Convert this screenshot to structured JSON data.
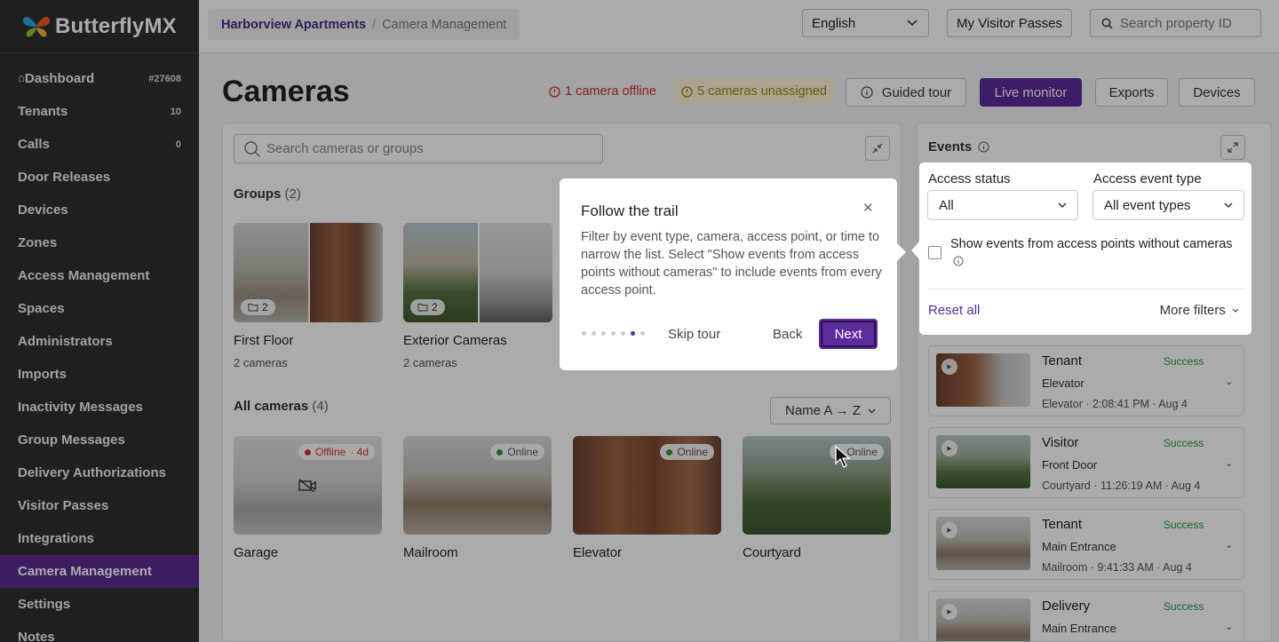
{
  "brand": {
    "name": "ButterflyMX"
  },
  "sidebar": {
    "items": [
      {
        "label": "Dashboard",
        "count": "#27608"
      },
      {
        "label": "Tenants",
        "count": "10"
      },
      {
        "label": "Calls",
        "count": "0"
      },
      {
        "label": "Door Releases",
        "count": ""
      },
      {
        "label": "Devices",
        "count": ""
      },
      {
        "label": "Zones",
        "count": ""
      },
      {
        "label": "Access Management",
        "count": ""
      },
      {
        "label": "Spaces",
        "count": ""
      },
      {
        "label": "Administrators",
        "count": ""
      },
      {
        "label": "Imports",
        "count": ""
      },
      {
        "label": "Inactivity Messages",
        "count": ""
      },
      {
        "label": "Group Messages",
        "count": ""
      },
      {
        "label": "Delivery Authorizations",
        "count": ""
      },
      {
        "label": "Visitor Passes",
        "count": ""
      },
      {
        "label": "Integrations",
        "count": ""
      },
      {
        "label": "Camera Management",
        "count": ""
      },
      {
        "label": "Settings",
        "count": ""
      },
      {
        "label": "Notes",
        "count": ""
      }
    ],
    "active_index": 15
  },
  "topbar": {
    "breadcrumb": {
      "property": "Harborview Apartments",
      "separator": "/",
      "page": "Camera Management"
    },
    "language": "English",
    "visitor_passes": "My Visitor Passes",
    "search_placeholder": "Search property ID"
  },
  "header": {
    "title": "Cameras",
    "offline": "1 camera offline",
    "unassigned": "5 cameras unassigned",
    "guided_tour": "Guided tour",
    "live_monitor": "Live monitor",
    "exports": "Exports",
    "devices": "Devices"
  },
  "cameras_panel": {
    "search_placeholder": "Search cameras or groups",
    "groups_label": "Groups",
    "groups_count": "(2)",
    "groups": [
      {
        "name": "First Floor",
        "sub": "2 cameras",
        "count": "2"
      },
      {
        "name": "Exterior Cameras",
        "sub": "2 cameras",
        "count": "2"
      }
    ],
    "all_label": "All cameras",
    "all_count": "(4)",
    "sort": "Name A → Z",
    "cameras": [
      {
        "name": "Garage",
        "status": "Offline",
        "extra": "· 4d"
      },
      {
        "name": "Mailroom",
        "status": "Online",
        "extra": ""
      },
      {
        "name": "Elevator",
        "status": "Online",
        "extra": ""
      },
      {
        "name": "Courtyard",
        "status": "Online",
        "extra": ""
      }
    ]
  },
  "events": {
    "title": "Events",
    "filters": {
      "access_status_label": "Access status",
      "access_status_value": "All",
      "event_type_label": "Access event type",
      "event_type_value": "All event types",
      "checkbox_label": "Show events from access points without cameras",
      "reset": "Reset all",
      "more": "More filters"
    },
    "items": [
      {
        "type": "Tenant",
        "status": "Success",
        "location": "Elevator",
        "meta": "Elevator · 2:08:41 PM · Aug 4"
      },
      {
        "type": "Visitor",
        "status": "Success",
        "location": "Front Door",
        "meta": "Courtyard · 11:26:19 AM · Aug 4"
      },
      {
        "type": "Tenant",
        "status": "Success",
        "location": "Main Entrance",
        "meta": "Mailroom · 9:41:33 AM · Aug 4"
      },
      {
        "type": "Delivery",
        "status": "Success",
        "location": "Main Entrance",
        "meta": ""
      }
    ]
  },
  "tour": {
    "title": "Follow the trail",
    "body": "Filter by event type, camera, access point, or time to narrow the list. Select \"Show events from access points without cameras\" to include events from every access point.",
    "skip": "Skip tour",
    "back": "Back",
    "next": "Next",
    "step_current": 6,
    "step_total": 7
  },
  "colors": {
    "brand": "#5c2c9a",
    "offline": "#d03030",
    "online": "#2b9a4a",
    "warning": "#a38a15"
  }
}
